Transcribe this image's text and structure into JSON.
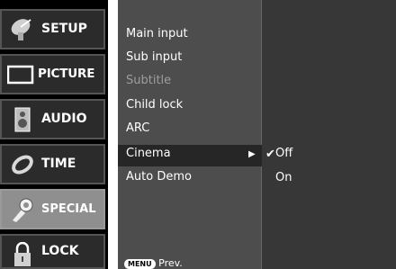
{
  "sidebar": {
    "items": [
      {
        "label": "SETUP",
        "icon": "satellite-dish-icon",
        "active": false
      },
      {
        "label": "PICTURE",
        "icon": "tv-screen-icon",
        "active": false
      },
      {
        "label": "AUDIO",
        "icon": "speaker-icon",
        "active": false
      },
      {
        "label": "TIME",
        "icon": "clock-icon",
        "active": false
      },
      {
        "label": "SPECIAL",
        "icon": "hand-tool-icon",
        "active": true
      },
      {
        "label": "LOCK",
        "icon": "padlock-icon",
        "active": false
      }
    ]
  },
  "menu": {
    "items": [
      {
        "label": "Main input",
        "enabled": true
      },
      {
        "label": "Sub input",
        "enabled": true
      },
      {
        "label": "Subtitle",
        "enabled": false
      },
      {
        "label": "Child lock",
        "enabled": true
      },
      {
        "label": "ARC",
        "enabled": true
      },
      {
        "label": "Cinema",
        "enabled": true,
        "selected": true
      },
      {
        "label": "Auto Demo",
        "enabled": true
      }
    ],
    "arrow": "▶"
  },
  "submenu": {
    "checkmark": "✔",
    "options": [
      {
        "label": "Off",
        "checked": true
      },
      {
        "label": "On",
        "checked": false
      }
    ]
  },
  "footer": {
    "key_label": "MENU",
    "action_label": "Prev."
  },
  "colors": {
    "sidebar_bg": "#2b2b2b",
    "sidebar_active": "#8f8f8f",
    "menu_bg": "#4d4d4d",
    "highlight": "#262626",
    "disabled_text": "#9d9d9d"
  }
}
